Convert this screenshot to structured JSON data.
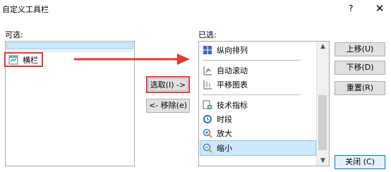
{
  "window": {
    "title": "自定义工具栏",
    "help": "?",
    "close": "✕"
  },
  "available": {
    "label": "可选:",
    "items": [
      {
        "label": "横栏",
        "icon": "horizontal-bar-icon"
      }
    ]
  },
  "middle": {
    "select_button": "选取(I) ->",
    "remove_button": "<- 移除(e)"
  },
  "selected": {
    "label": "已选:",
    "items": [
      {
        "label": "纵向排列",
        "icon": "vertical-arrange-icon"
      },
      {
        "separator": true
      },
      {
        "label": "自动滚动",
        "icon": "auto-scroll-icon"
      },
      {
        "label": "平移图表",
        "icon": "pan-chart-icon"
      },
      {
        "separator": true
      },
      {
        "label": "技术指标",
        "icon": "technical-indicator-icon"
      },
      {
        "label": "时段",
        "icon": "clock-icon"
      },
      {
        "label": "放大",
        "icon": "zoom-in-icon"
      },
      {
        "label": "缩小",
        "icon": "zoom-out-icon",
        "selected": true
      }
    ]
  },
  "side_buttons": {
    "up": "上移(U)",
    "down": "下移(D)",
    "reset": "重置(R)",
    "close": "关闭 (C)"
  },
  "colors": {
    "highlight_red": "#e53935",
    "selection": "#cce8ff"
  }
}
